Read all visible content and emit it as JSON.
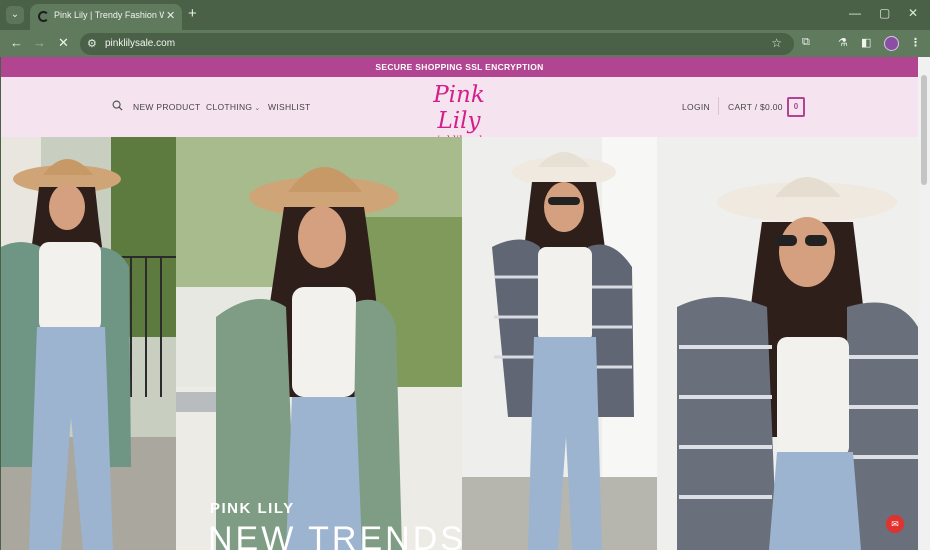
{
  "browser": {
    "tab_title": "Pink Lily | Trendy Fashion Wom",
    "tab_close": "✕",
    "new_tab": "+",
    "url": "pinklilysale.com",
    "controls": {
      "minimize": "—",
      "maximize": "▢",
      "close": "✕"
    },
    "toolbar_icons": [
      "back-icon",
      "forward-icon",
      "stop-loading-icon",
      "site-info-icon",
      "bookmark-star-icon",
      "extensions-icon",
      "labs-icon",
      "side-panel-icon",
      "profile-avatar",
      "menu-icon"
    ]
  },
  "promo": {
    "text": "SECURE SHOPPING SSL ENCRYPTION"
  },
  "header": {
    "nav": [
      {
        "label": "NEW PRODUCT"
      },
      {
        "label": "CLOTHING",
        "has_dropdown": true
      },
      {
        "label": "WISHLIST"
      }
    ],
    "logo": {
      "main": "Pink Lily",
      "sub": "pinklilysale"
    },
    "login": "LOGIN",
    "cart": {
      "label": "CART / $0.00",
      "count": "0"
    }
  },
  "hero": {
    "kicker": "PINK LILY",
    "title": "NEW TRENDS"
  },
  "colors": {
    "browser_frame": "#4a6148",
    "promo_bar": "#b14591",
    "header_bg": "#f5e4ef",
    "logo": "#d21f8a"
  }
}
